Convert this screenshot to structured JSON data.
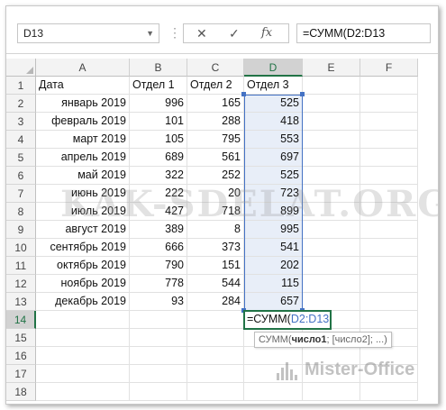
{
  "formula_bar": {
    "name_box": "D13",
    "cancel_symbol": "✕",
    "enter_symbol": "✓",
    "fx_symbol": "fx",
    "formula": "=СУММ(D2:D13"
  },
  "columns": [
    "A",
    "B",
    "C",
    "D",
    "E",
    "F"
  ],
  "rows": [
    "1",
    "2",
    "3",
    "4",
    "5",
    "6",
    "7",
    "8",
    "9",
    "10",
    "11",
    "12",
    "13",
    "14",
    "15",
    "16",
    "17",
    "18"
  ],
  "table": {
    "headers": [
      "Дата",
      "Отдел 1",
      "Отдел 2",
      "Отдел 3"
    ],
    "rows": [
      [
        "январь 2019",
        "996",
        "165",
        "525"
      ],
      [
        "февраль 2019",
        "101",
        "288",
        "418"
      ],
      [
        "март 2019",
        "105",
        "795",
        "553"
      ],
      [
        "апрель 2019",
        "689",
        "561",
        "697"
      ],
      [
        "май 2019",
        "322",
        "252",
        "525"
      ],
      [
        "июнь 2019",
        "222",
        "20",
        "723"
      ],
      [
        "июль 2019",
        "427",
        "718",
        "899"
      ],
      [
        "август 2019",
        "389",
        "8",
        "995"
      ],
      [
        "сентябрь 2019",
        "666",
        "373",
        "541"
      ],
      [
        "октябрь 2019",
        "790",
        "151",
        "202"
      ],
      [
        "ноябрь 2019",
        "778",
        "544",
        "115"
      ],
      [
        "декабрь 2019",
        "93",
        "284",
        "657"
      ]
    ]
  },
  "active_cell": {
    "prefix": "=СУММ(",
    "ref": "D2:D13"
  },
  "tooltip": {
    "func": "СУММ(",
    "arg1": "число1",
    "rest": "; [число2]; ...)"
  },
  "watermarks": {
    "main": "KAK-SDELAT.ORG",
    "brand": "Mister-Office"
  },
  "colors": {
    "excel_green": "#217346",
    "range_blue": "#4472c4",
    "range_fill": "#e8eef8"
  }
}
